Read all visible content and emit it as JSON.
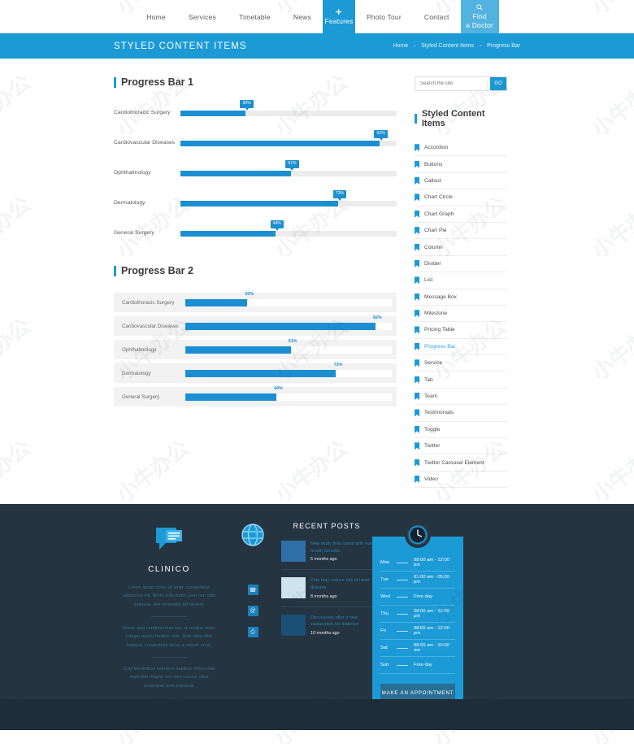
{
  "nav": {
    "items": [
      {
        "label": "Home",
        "type": "plain"
      },
      {
        "label": "Services",
        "type": "plain"
      },
      {
        "label": "Timetable",
        "type": "plain"
      },
      {
        "label": "News",
        "type": "plain"
      },
      {
        "label": "Features",
        "type": "boxed",
        "icon": "plus-icon"
      },
      {
        "label": "Photo Tour",
        "type": "plain"
      },
      {
        "label": "Contact",
        "type": "plain"
      },
      {
        "label": "Find\na Doctor",
        "type": "doctor",
        "icon": "search-icon"
      }
    ]
  },
  "header": {
    "title": "STYLED CONTENT ITEMS",
    "breadcrumb": [
      "Home",
      "Styled Content Items",
      "Progress Bar"
    ],
    "separator": "›"
  },
  "main": {
    "section1_title": "Progress Bar 1",
    "section2_title": "Progress Bar 2",
    "bars": [
      {
        "label": "Cardiothoracic Surgery",
        "value": 30,
        "display": "30%"
      },
      {
        "label": "Cardiovascular Diseases",
        "value": 92,
        "display": "92%"
      },
      {
        "label": "Ophthalmology",
        "value": 51,
        "display": "51%"
      },
      {
        "label": "Dermatology",
        "value": 73,
        "display": "73%"
      },
      {
        "label": "General Surgery",
        "value": 44,
        "display": "44%"
      }
    ]
  },
  "sidebar": {
    "search_placeholder": "Search the site",
    "search_value": "",
    "go_label": "GO",
    "title": "Styled Content Items",
    "items": [
      {
        "label": "Accordion",
        "active": false
      },
      {
        "label": "Buttons",
        "active": false
      },
      {
        "label": "Callout",
        "active": false
      },
      {
        "label": "Chart Circle",
        "active": false
      },
      {
        "label": "Chart Graph",
        "active": false
      },
      {
        "label": "Chart Pie",
        "active": false
      },
      {
        "label": "Column",
        "active": false
      },
      {
        "label": "Divider",
        "active": false
      },
      {
        "label": "List",
        "active": false
      },
      {
        "label": "Message Box",
        "active": false
      },
      {
        "label": "Milestone",
        "active": false
      },
      {
        "label": "Pricing Table",
        "active": false
      },
      {
        "label": "Progress Bar",
        "active": true
      },
      {
        "label": "Service",
        "active": false
      },
      {
        "label": "Tab",
        "active": false
      },
      {
        "label": "Team",
        "active": false
      },
      {
        "label": "Testimonials",
        "active": false
      },
      {
        "label": "Toggle",
        "active": false
      },
      {
        "label": "Twitter",
        "active": false
      },
      {
        "label": "Twitter Carousel Element",
        "active": false
      },
      {
        "label": "Video",
        "active": false
      }
    ]
  },
  "footer": {
    "brand": {
      "icon": "chat-bubble-icon",
      "name": "CLINICO",
      "paragraphs": [
        "Lorem ipsum dolor sit amet, consectetur adipiscing elit. Morbi sollicitudin justo non odio molestie, sed venenatis elit laoreet.",
        "Donec quis condimentum leo, at congue dolor. Integer auctor facilisis odio. Duis vitae nibh tristique, consectetur lacus a, rutrum enim.",
        "Cras fermentum interdum dapibus. Maecenas imperdiet magna nec odio cursus, vitae consequat ante euismod."
      ]
    },
    "social": {
      "globe_icon": "globe-icon",
      "links": [
        {
          "icon": "phone-icon",
          "glyph": "☎"
        },
        {
          "icon": "email-icon",
          "glyph": "@"
        },
        {
          "icon": "print-icon",
          "glyph": "⎙"
        }
      ]
    },
    "posts": {
      "title": "RECENT POSTS",
      "items": [
        {
          "title": "New study links lutein with eye health benefits",
          "date": "5 months ago",
          "thumb": "microscope-photo"
        },
        {
          "title": "Pets may reduce risk of heart disease",
          "date": "8 months ago",
          "thumb": "pills-photo"
        },
        {
          "title": "Discoveries offer a new explanation for diabetes",
          "date": "10 months ago",
          "thumb": "syringe-photo"
        }
      ]
    },
    "schedule": {
      "clock_icon": "clock-icon",
      "rows": [
        {
          "day": "Mon",
          "hours": "08:00 am - 12:00 pm"
        },
        {
          "day": "Tue",
          "hours": "01:00 am - 05:00 pm"
        },
        {
          "day": "Wed",
          "hours": "Free day"
        },
        {
          "day": "Thu",
          "hours": "08:00 am - 12:00 pm"
        },
        {
          "day": "Fri",
          "hours": "08:00 am - 12:00 pm"
        },
        {
          "day": "Sat",
          "hours": "08:00 am - 10:00 am"
        },
        {
          "day": "Sun",
          "hours": "Free day"
        }
      ],
      "button_label": "MAKE AN APPOINTMENT"
    }
  },
  "colors": {
    "accent": "#1b9ad6",
    "accent_dark": "#1b8fd1",
    "doctor_btn": "#52b3e0",
    "footer_bg": "#243440",
    "footer_bottom": "#1f2d38",
    "track": "#ececec"
  },
  "watermark": {
    "text": "小牛办公"
  }
}
